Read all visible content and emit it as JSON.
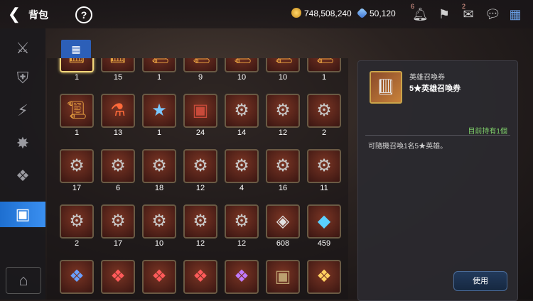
{
  "header": {
    "title": "背包",
    "help_label": "?"
  },
  "currency": {
    "gold": "748,508,240",
    "crystal": "50,120"
  },
  "topbar_badges": {
    "bell": "6",
    "mail": "2"
  },
  "inventory": {
    "items": [
      {
        "count": "1",
        "icon": "hero-book"
      },
      {
        "count": "15",
        "icon": "hero-book"
      },
      {
        "count": "1",
        "icon": "scroll-arrow"
      },
      {
        "count": "9",
        "icon": "scroll-arrow"
      },
      {
        "count": "10",
        "icon": "scroll-arrow"
      },
      {
        "count": "10",
        "icon": "scroll-arrow"
      },
      {
        "count": "1",
        "icon": "scroll-arrow"
      },
      {
        "count": "1",
        "icon": "scroll-arrow"
      },
      {
        "count": "13",
        "icon": "red-potion"
      },
      {
        "count": "1",
        "icon": "star-wand"
      },
      {
        "count": "24",
        "icon": "red-chest"
      },
      {
        "count": "14",
        "icon": "gear-chest"
      },
      {
        "count": "12",
        "icon": "gear-chest"
      },
      {
        "count": "2",
        "icon": "gear-chest"
      },
      {
        "count": "17",
        "icon": "gear-chest"
      },
      {
        "count": "6",
        "icon": "gear-chest"
      },
      {
        "count": "18",
        "icon": "gear-chest"
      },
      {
        "count": "12",
        "icon": "gear-chest"
      },
      {
        "count": "4",
        "icon": "gear-chest"
      },
      {
        "count": "16",
        "icon": "gear-chest"
      },
      {
        "count": "11",
        "icon": "gear-chest"
      },
      {
        "count": "2",
        "icon": "gear-chest"
      },
      {
        "count": "17",
        "icon": "gear-chest"
      },
      {
        "count": "10",
        "icon": "gear-chest"
      },
      {
        "count": "12",
        "icon": "gear-chest"
      },
      {
        "count": "12",
        "icon": "gear-chest"
      },
      {
        "count": "608",
        "icon": "silver-chest"
      },
      {
        "count": "459",
        "icon": "crystal-chest"
      },
      {
        "count": "",
        "icon": "blue-gift"
      },
      {
        "count": "",
        "icon": "red-gift"
      },
      {
        "count": "",
        "icon": "red-gift"
      },
      {
        "count": "",
        "icon": "red-gift"
      },
      {
        "count": "",
        "icon": "purple-gift"
      },
      {
        "count": "",
        "icon": "dark-chest"
      },
      {
        "count": "",
        "icon": "gold-gift"
      }
    ]
  },
  "detail": {
    "name": "英雄召喚券",
    "subtitle": "5★英雄召喚券",
    "owned": "目前持有1個",
    "description": "可隨機召喚1名5★英雄。",
    "use_label": "使用"
  }
}
